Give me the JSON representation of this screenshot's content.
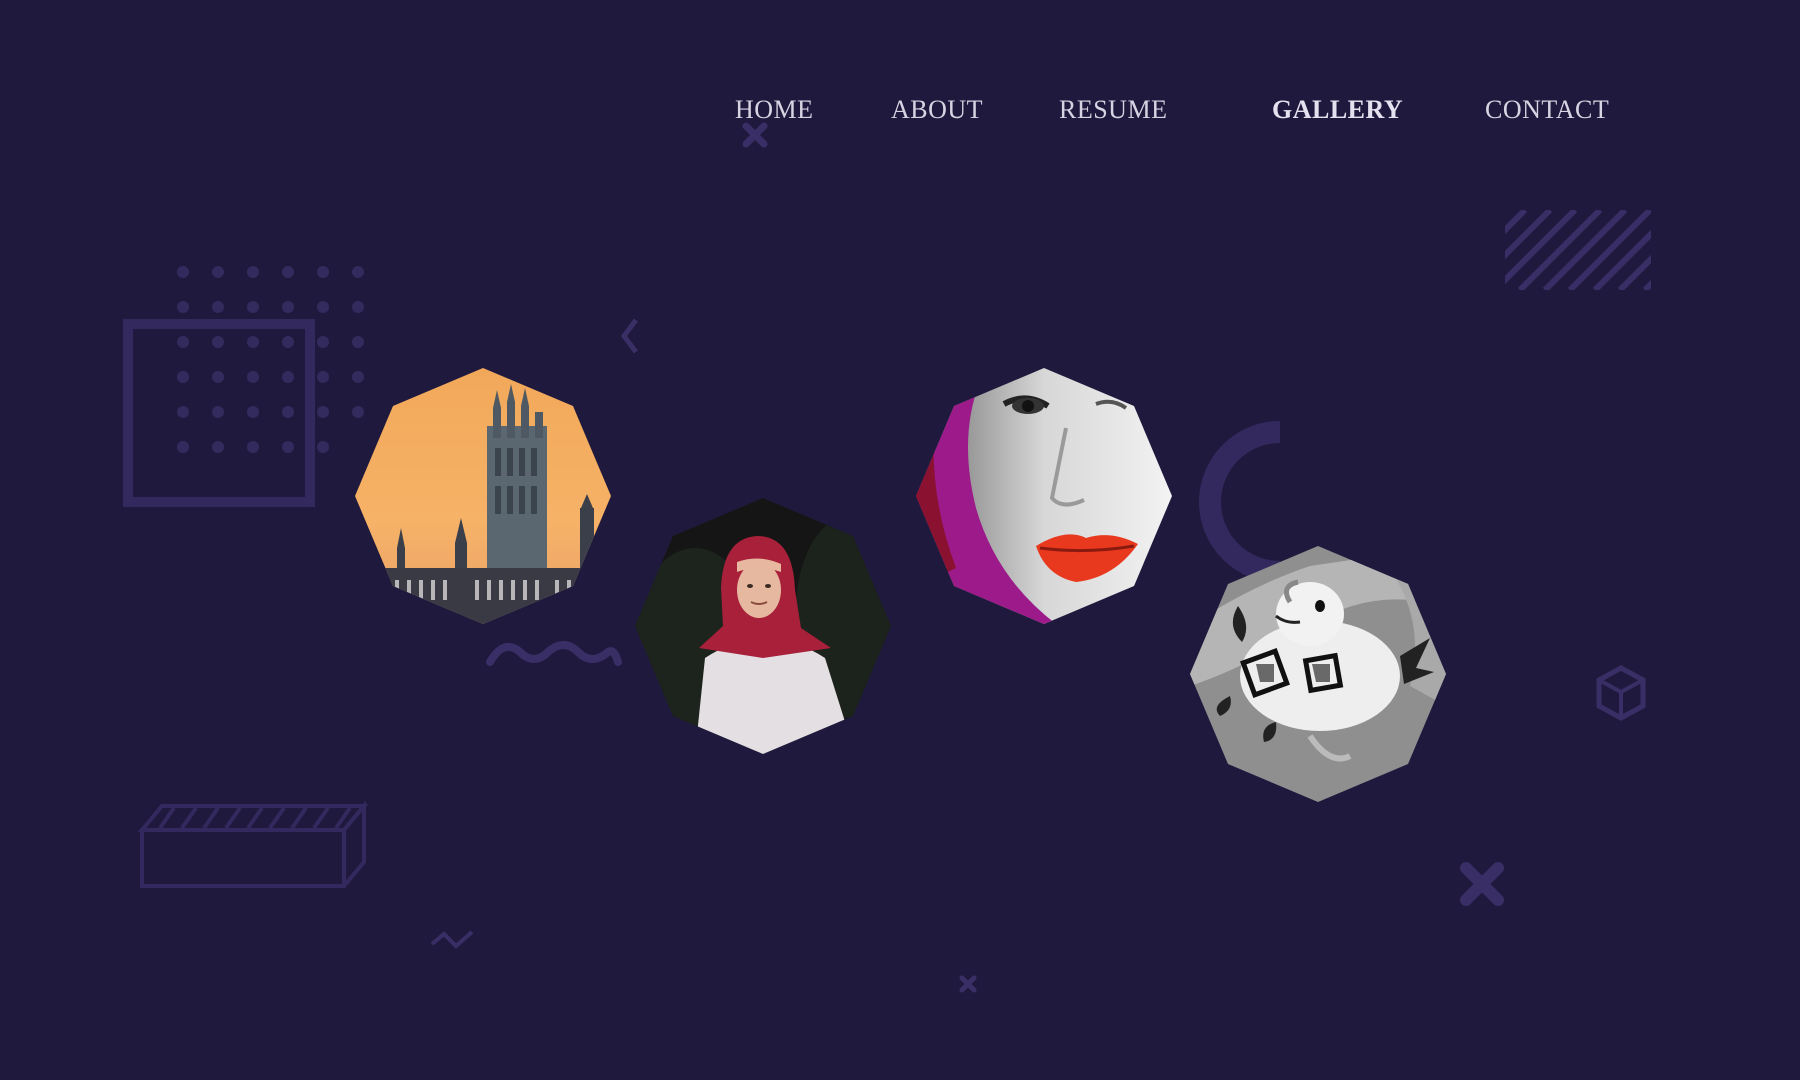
{
  "nav": {
    "items": [
      {
        "id": "home",
        "label": "HOME"
      },
      {
        "id": "about",
        "label": "ABOUT"
      },
      {
        "id": "resume",
        "label": "RESUME"
      },
      {
        "id": "gallery",
        "label": "GALLERY",
        "active": true
      },
      {
        "id": "contact",
        "label": "CONTACT"
      }
    ]
  },
  "gallery": {
    "items": [
      {
        "name": "gallery-image-westminster",
        "subject": "Westminster Palace tower at sunset"
      },
      {
        "name": "gallery-image-portrait-hijab",
        "subject": "Portrait of a woman wearing a red hijab"
      },
      {
        "name": "gallery-image-face-red-lips",
        "subject": "Stylized face with red lips and magenta hair"
      },
      {
        "name": "gallery-image-bird-illustration",
        "subject": "Grayscale bird illustration"
      }
    ]
  },
  "colors": {
    "background": "#1f1a3d",
    "decor": "#3a2e66",
    "nav_text": "#d8d3e2"
  },
  "icons": [
    "dots-grid-icon",
    "square-outline-icon",
    "chevron-icon",
    "wave-icon",
    "stripes-icon",
    "arc-icon",
    "hexagon-cube-icon",
    "cross-icon",
    "box-3d-icon",
    "zigzag-icon"
  ]
}
